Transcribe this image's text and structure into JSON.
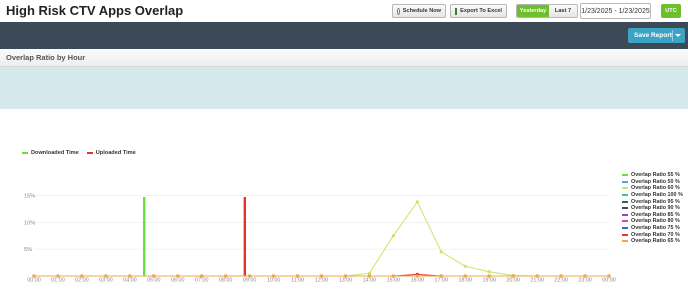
{
  "header": {
    "title": "High Risk CTV Apps Overlap",
    "schedule_label": "Schedule Now",
    "export_label": "Export To Excel",
    "yesterday_label": "Yesterday",
    "last7_label": "Last 7",
    "date_range": "1/23/2025 - 1/23/2025",
    "utc_label": "UTC"
  },
  "toolbar": {
    "save_report_label": "Save Report"
  },
  "section": {
    "title": "Overlap Ratio by Hour"
  },
  "colors": {
    "accent_green": "#6dbf2b",
    "toolbar_bg": "#3b4a56",
    "save_blue": "#3ba3c3",
    "band": "#d5e9ec",
    "downloaded": "#66e23a",
    "uploaded": "#e8332b",
    "ratio_60": "#c9e46a"
  },
  "chart_data": {
    "type": "line",
    "categories": [
      "00:00",
      "01:00",
      "02:00",
      "03:00",
      "04:00",
      "05:00",
      "06:00",
      "07:00",
      "08:00",
      "09:00",
      "10:00",
      "11:00",
      "12:00",
      "13:00",
      "14:00",
      "15:00",
      "16:00",
      "17:00",
      "18:00",
      "19:00",
      "20:00",
      "21:00",
      "22:00",
      "23:00",
      "00:00"
    ],
    "ylim": [
      0,
      16
    ],
    "yticks": [
      {
        "value": 5,
        "label": "5%"
      },
      {
        "value": 10,
        "label": "10%"
      },
      {
        "value": 15,
        "label": "15%"
      }
    ],
    "markers": [
      {
        "name": "Downloaded Time",
        "color": "#66e23a",
        "at_hour": 4.6
      },
      {
        "name": "Uploaded Time",
        "color": "#e8332b",
        "at_hour": 8.8
      }
    ],
    "series": [
      {
        "name": "Overlap Ratio 55 %",
        "color": "#66e23a",
        "values": []
      },
      {
        "name": "Overlap Ratio 50 %",
        "color": "#4aa8e8",
        "values": []
      },
      {
        "name": "Overlap Ratio 60 %",
        "color": "#c9e46a",
        "values": [
          0,
          0,
          0,
          0,
          0,
          0,
          0,
          0,
          0,
          0,
          0,
          0,
          0,
          0,
          0.5,
          7.5,
          13.8,
          4.5,
          1.8,
          0.8,
          0.1,
          0,
          0,
          0,
          0
        ]
      },
      {
        "name": "Overlap Ratio 100 %",
        "color": "#3dbfa8",
        "values": []
      },
      {
        "name": "Overlap Ratio 95 %",
        "color": "#2f6e3a",
        "values": []
      },
      {
        "name": "Overlap Ratio 90 %",
        "color": "#4a4a4a",
        "values": []
      },
      {
        "name": "Overlap Ratio 85 %",
        "color": "#8a4ac8",
        "values": []
      },
      {
        "name": "Overlap Ratio 80 %",
        "color": "#d84aa8",
        "values": []
      },
      {
        "name": "Overlap Ratio 75 %",
        "color": "#3a6ad8",
        "values": []
      },
      {
        "name": "Overlap Ratio 70 %",
        "color": "#e8332b",
        "values": [
          0,
          0,
          0,
          0,
          0,
          0,
          0,
          0,
          0,
          0,
          0,
          0,
          0,
          0,
          0,
          0,
          0.3,
          0,
          0,
          0,
          0,
          0,
          0,
          0,
          0
        ]
      },
      {
        "name": "Overlap Ratio 65 %",
        "color": "#f0a848",
        "values": [
          0,
          0,
          0,
          0,
          0,
          0,
          0,
          0,
          0,
          0,
          0,
          0,
          0,
          0,
          0,
          0,
          0,
          0,
          0,
          0,
          0,
          0,
          0,
          0,
          0
        ]
      }
    ]
  }
}
